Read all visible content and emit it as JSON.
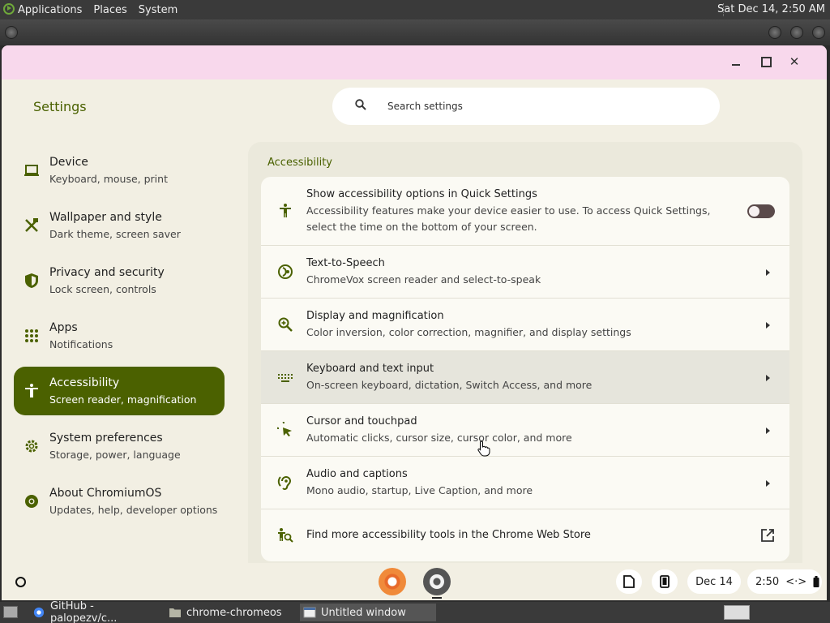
{
  "top_panel": {
    "menus": [
      "Applications",
      "Places",
      "System"
    ],
    "clock": "Sat Dec 14,  2:50 AM"
  },
  "window": {
    "close_glyph": "✕"
  },
  "settings": {
    "title": "Settings",
    "search_placeholder": "Search settings"
  },
  "sidebar": {
    "items": [
      {
        "label": "Device",
        "sub": "Keyboard, mouse, print",
        "icon": "laptop-icon"
      },
      {
        "label": "Wallpaper and style",
        "sub": "Dark theme, screen saver",
        "icon": "paint-icon"
      },
      {
        "label": "Privacy and security",
        "sub": "Lock screen, controls",
        "icon": "shield-icon"
      },
      {
        "label": "Apps",
        "sub": "Notifications",
        "icon": "apps-grid-icon"
      },
      {
        "label": "Accessibility",
        "sub": "Screen reader, magnification",
        "icon": "accessibility-icon",
        "active": true
      },
      {
        "label": "System preferences",
        "sub": "Storage, power, language",
        "icon": "gear-icon"
      },
      {
        "label": "About ChromiumOS",
        "sub": "Updates, help, developer options",
        "icon": "chromium-icon"
      }
    ]
  },
  "main": {
    "section_title": "Accessibility",
    "rows": [
      {
        "title": "Show accessibility options in Quick Settings",
        "desc": "Accessibility features make your device easier to use. To access Quick Settings, select the time on the bottom of your screen.",
        "toggle": false
      },
      {
        "title": "Text-to-Speech",
        "desc": "ChromeVox screen reader and select-to-speak"
      },
      {
        "title": "Display and magnification",
        "desc": "Color inversion, color correction, magnifier, and display settings"
      },
      {
        "title": "Keyboard and text input",
        "desc": "On-screen keyboard, dictation, Switch Access, and more"
      },
      {
        "title": "Cursor and touchpad",
        "desc": "Automatic clicks, cursor size, cursor color, and more"
      },
      {
        "title": "Audio and captions",
        "desc": "Mono audio, startup, Live Caption, and more"
      },
      {
        "title": "Find more accessibility tools in the Chrome Web Store",
        "desc": ""
      }
    ]
  },
  "shelf": {
    "date": "Dec 14",
    "time": "2:50",
    "network_glyph": "<·>"
  },
  "taskbar": {
    "tasks": [
      "GitHub - palopezv/c...",
      "chrome-chromeos",
      "Untitled window"
    ]
  },
  "colors": {
    "accent": "#4b6100",
    "caption": "#f8d8ec",
    "background": "#f2efe3"
  }
}
